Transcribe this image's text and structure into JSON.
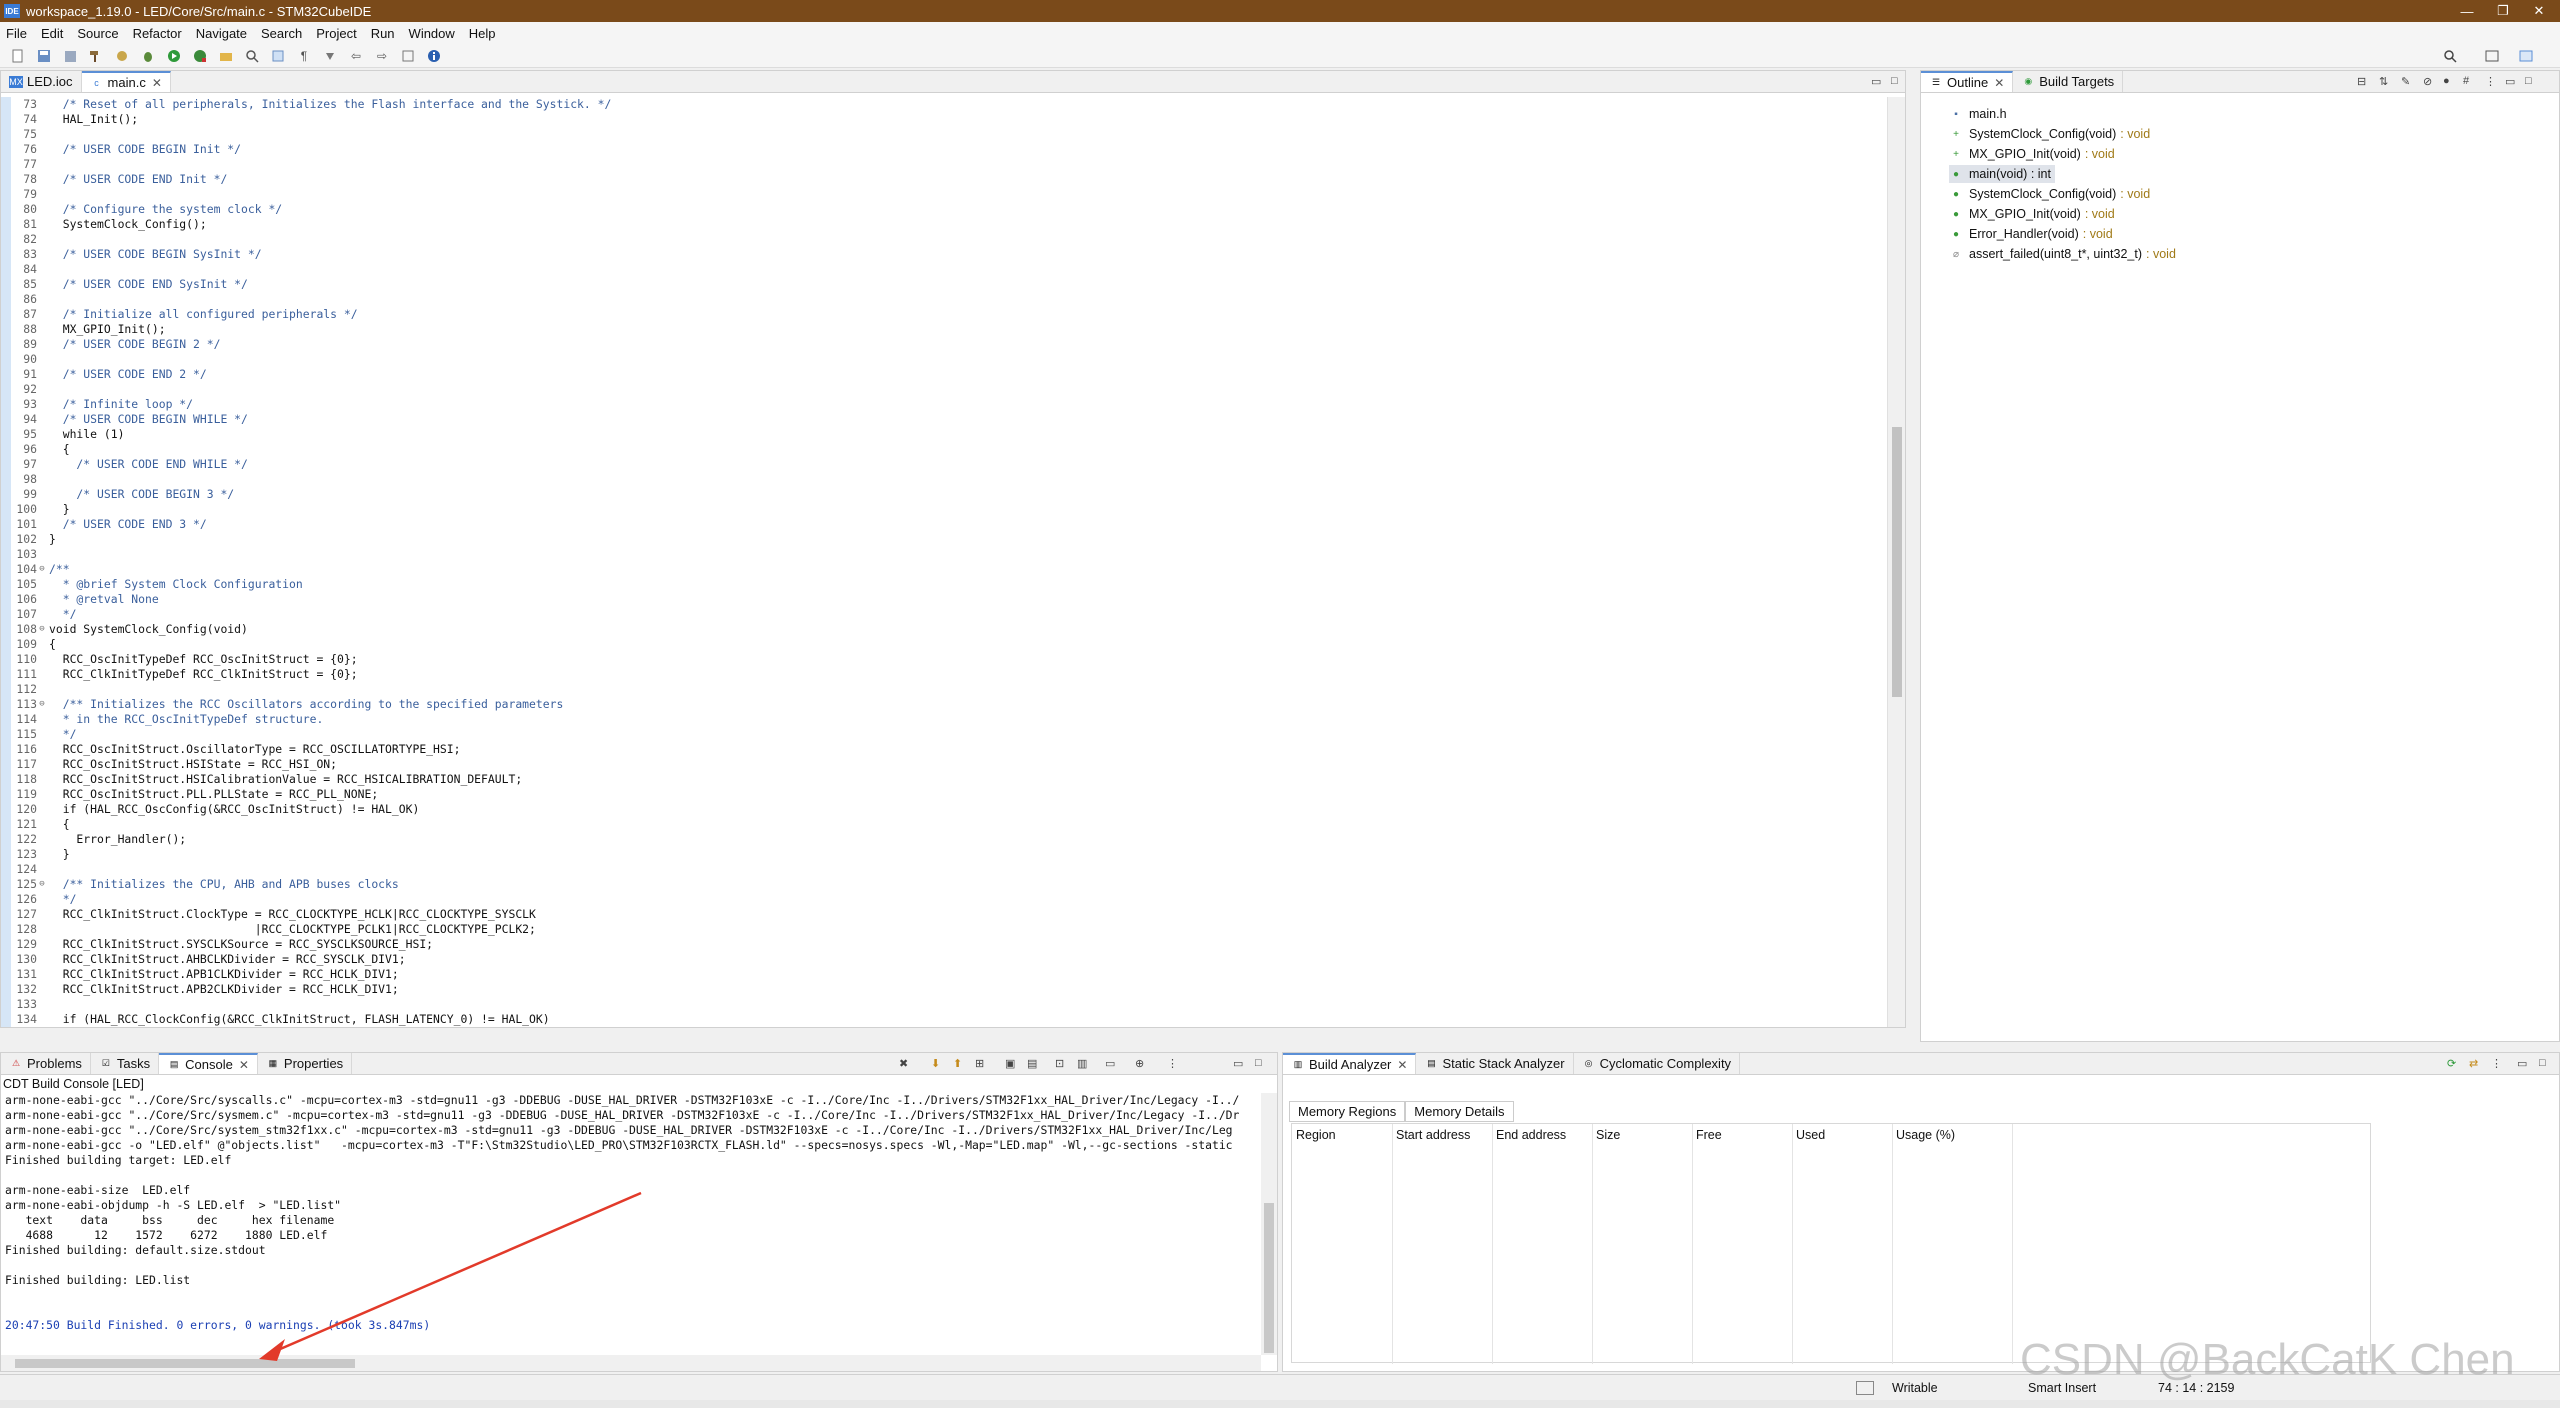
{
  "window": {
    "title": "workspace_1.19.0 - LED/Core/Src/main.c - STM32CubeIDE",
    "logo": "IDE",
    "controls": [
      "—",
      "❐",
      "✕"
    ]
  },
  "menu": [
    "File",
    "Edit",
    "Source",
    "Refactor",
    "Navigate",
    "Search",
    "Project",
    "Run",
    "Window",
    "Help"
  ],
  "editor": {
    "tabs": [
      {
        "label": "LED.ioc",
        "icon": "MX"
      },
      {
        "label": "main.c",
        "icon": "c",
        "close": "✕"
      }
    ],
    "lines": [
      {
        "n": "73",
        "t": "  /* Reset of all peripherals, Initializes the Flash interface and the Systick. */",
        "c": true
      },
      {
        "n": "74",
        "t": "  HAL_Init();",
        "c": false
      },
      {
        "n": "75",
        "t": "",
        "c": false
      },
      {
        "n": "76",
        "t": "  /* USER CODE BEGIN Init */",
        "c": true
      },
      {
        "n": "77",
        "t": "",
        "c": false
      },
      {
        "n": "78",
        "t": "  /* USER CODE END Init */",
        "c": true
      },
      {
        "n": "79",
        "t": "",
        "c": false
      },
      {
        "n": "80",
        "t": "  /* Configure the system clock */",
        "c": true
      },
      {
        "n": "81",
        "t": "  SystemClock_Config();",
        "c": false
      },
      {
        "n": "82",
        "t": "",
        "c": false
      },
      {
        "n": "83",
        "t": "  /* USER CODE BEGIN SysInit */",
        "c": true
      },
      {
        "n": "84",
        "t": "",
        "c": false
      },
      {
        "n": "85",
        "t": "  /* USER CODE END SysInit */",
        "c": true
      },
      {
        "n": "86",
        "t": "",
        "c": false
      },
      {
        "n": "87",
        "t": "  /* Initialize all configured peripherals */",
        "c": true
      },
      {
        "n": "88",
        "t": "  MX_GPIO_Init();",
        "c": false
      },
      {
        "n": "89",
        "t": "  /* USER CODE BEGIN 2 */",
        "c": true
      },
      {
        "n": "90",
        "t": "",
        "c": false
      },
      {
        "n": "91",
        "t": "  /* USER CODE END 2 */",
        "c": true
      },
      {
        "n": "92",
        "t": "",
        "c": false
      },
      {
        "n": "93",
        "t": "  /* Infinite loop */",
        "c": true
      },
      {
        "n": "94",
        "t": "  /* USER CODE BEGIN WHILE */",
        "c": true
      },
      {
        "n": "95",
        "t": "  while (1)",
        "c": false
      },
      {
        "n": "96",
        "t": "  {",
        "c": false
      },
      {
        "n": "97",
        "t": "    /* USER CODE END WHILE */",
        "c": true
      },
      {
        "n": "98",
        "t": "",
        "c": false
      },
      {
        "n": "99",
        "t": "    /* USER CODE BEGIN 3 */",
        "c": true
      },
      {
        "n": "100",
        "t": "  }",
        "c": false
      },
      {
        "n": "101",
        "t": "  /* USER CODE END 3 */",
        "c": true
      },
      {
        "n": "102",
        "t": "}",
        "c": false
      },
      {
        "n": "103",
        "t": "",
        "c": false
      },
      {
        "n": "104",
        "t": "/**",
        "c": true,
        "f": "⊖"
      },
      {
        "n": "105",
        "t": "  * @brief System Clock Configuration",
        "c": true
      },
      {
        "n": "106",
        "t": "  * @retval None",
        "c": true
      },
      {
        "n": "107",
        "t": "  */",
        "c": true
      },
      {
        "n": "108",
        "t": "void SystemClock_Config(void)",
        "c": false,
        "f": "⊖"
      },
      {
        "n": "109",
        "t": "{",
        "c": false
      },
      {
        "n": "110",
        "t": "  RCC_OscInitTypeDef RCC_OscInitStruct = {0};",
        "c": false
      },
      {
        "n": "111",
        "t": "  RCC_ClkInitTypeDef RCC_ClkInitStruct = {0};",
        "c": false
      },
      {
        "n": "112",
        "t": "",
        "c": false
      },
      {
        "n": "113",
        "t": "  /** Initializes the RCC Oscillators according to the specified parameters",
        "c": true,
        "f": "⊖"
      },
      {
        "n": "114",
        "t": "  * in the RCC_OscInitTypeDef structure.",
        "c": true
      },
      {
        "n": "115",
        "t": "  */",
        "c": true
      },
      {
        "n": "116",
        "t": "  RCC_OscInitStruct.OscillatorType = RCC_OSCILLATORTYPE_HSI;",
        "c": false
      },
      {
        "n": "117",
        "t": "  RCC_OscInitStruct.HSIState = RCC_HSI_ON;",
        "c": false
      },
      {
        "n": "118",
        "t": "  RCC_OscInitStruct.HSICalibrationValue = RCC_HSICALIBRATION_DEFAULT;",
        "c": false
      },
      {
        "n": "119",
        "t": "  RCC_OscInitStruct.PLL.PLLState = RCC_PLL_NONE;",
        "c": false
      },
      {
        "n": "120",
        "t": "  if (HAL_RCC_OscConfig(&RCC_OscInitStruct) != HAL_OK)",
        "c": false
      },
      {
        "n": "121",
        "t": "  {",
        "c": false
      },
      {
        "n": "122",
        "t": "    Error_Handler();",
        "c": false
      },
      {
        "n": "123",
        "t": "  }",
        "c": false
      },
      {
        "n": "124",
        "t": "",
        "c": false
      },
      {
        "n": "125",
        "t": "  /** Initializes the CPU, AHB and APB buses clocks",
        "c": true,
        "f": "⊖"
      },
      {
        "n": "126",
        "t": "  */",
        "c": true
      },
      {
        "n": "127",
        "t": "  RCC_ClkInitStruct.ClockType = RCC_CLOCKTYPE_HCLK|RCC_CLOCKTYPE_SYSCLK",
        "c": false
      },
      {
        "n": "128",
        "t": "                              |RCC_CLOCKTYPE_PCLK1|RCC_CLOCKTYPE_PCLK2;",
        "c": false
      },
      {
        "n": "129",
        "t": "  RCC_ClkInitStruct.SYSCLKSource = RCC_SYSCLKSOURCE_HSI;",
        "c": false
      },
      {
        "n": "130",
        "t": "  RCC_ClkInitStruct.AHBCLKDivider = RCC_SYSCLK_DIV1;",
        "c": false
      },
      {
        "n": "131",
        "t": "  RCC_ClkInitStruct.APB1CLKDivider = RCC_HCLK_DIV1;",
        "c": false
      },
      {
        "n": "132",
        "t": "  RCC_ClkInitStruct.APB2CLKDivider = RCC_HCLK_DIV1;",
        "c": false
      },
      {
        "n": "133",
        "t": "",
        "c": false
      },
      {
        "n": "134",
        "t": "  if (HAL_RCC_ClockConfig(&RCC_ClkInitStruct, FLASH_LATENCY_0) != HAL_OK)",
        "c": false
      }
    ]
  },
  "outline": {
    "tabs": [
      {
        "label": "Outline",
        "close": "✕"
      },
      {
        "label": "Build Targets"
      }
    ],
    "items": [
      {
        "name": "main.h",
        "ret": "",
        "icon": "▪",
        "color": "#4a6fa5"
      },
      {
        "name": "SystemClock_Config(void)",
        "ret": ": void",
        "icon": "+",
        "color": "#3a9a3a"
      },
      {
        "name": "MX_GPIO_Init(void)",
        "ret": ": void",
        "icon": "+",
        "color": "#3a9a3a"
      },
      {
        "name": "main(void) : int",
        "ret": "",
        "icon": "●",
        "color": "#3a9a3a"
      },
      {
        "name": "SystemClock_Config(void)",
        "ret": ": void",
        "icon": "●",
        "color": "#3a9a3a"
      },
      {
        "name": "MX_GPIO_Init(void)",
        "ret": ": void",
        "icon": "●",
        "color": "#3a9a3a"
      },
      {
        "name": "Error_Handler(void)",
        "ret": ": void",
        "icon": "●",
        "color": "#3a9a3a"
      },
      {
        "name": "assert_failed(uint8_t*, uint32_t)",
        "ret": ": void",
        "icon": "⌀",
        "color": "#888888"
      }
    ]
  },
  "console": {
    "tabs": [
      {
        "label": "Problems"
      },
      {
        "label": "Tasks"
      },
      {
        "label": "Console",
        "close": "✕"
      },
      {
        "label": "Properties"
      }
    ],
    "header": "CDT Build Console [LED]",
    "lines": [
      {
        "t": "arm-none-eabi-gcc \"../Core/Src/syscalls.c\" -mcpu=cortex-m3 -std=gnu11 -g3 -DDEBUG -DUSE_HAL_DRIVER -DSTM32F103xE -c -I../Core/Inc -I../Drivers/STM32F1xx_HAL_Driver/Inc/Legacy -I../",
        "blue": false
      },
      {
        "t": "arm-none-eabi-gcc \"../Core/Src/sysmem.c\" -mcpu=cortex-m3 -std=gnu11 -g3 -DDEBUG -DUSE_HAL_DRIVER -DSTM32F103xE -c -I../Core/Inc -I../Drivers/STM32F1xx_HAL_Driver/Inc/Legacy -I../Dr",
        "blue": false
      },
      {
        "t": "arm-none-eabi-gcc \"../Core/Src/system_stm32f1xx.c\" -mcpu=cortex-m3 -std=gnu11 -g3 -DDEBUG -DUSE_HAL_DRIVER -DSTM32F103xE -c -I../Core/Inc -I../Drivers/STM32F1xx_HAL_Driver/Inc/Leg",
        "blue": false
      },
      {
        "t": "arm-none-eabi-gcc -o \"LED.elf\" @\"objects.list\"   -mcpu=cortex-m3 -T\"F:\\Stm32Studio\\LED_PRO\\STM32F103RCTX_FLASH.ld\" --specs=nosys.specs -Wl,-Map=\"LED.map\" -Wl,--gc-sections -static",
        "blue": false
      },
      {
        "t": "Finished building target: LED.elf",
        "blue": false
      },
      {
        "t": "",
        "blue": false
      },
      {
        "t": "arm-none-eabi-size  LED.elf",
        "blue": false
      },
      {
        "t": "arm-none-eabi-objdump -h -S LED.elf  > \"LED.list\"",
        "blue": false
      },
      {
        "t": "   text    data     bss     dec     hex filename",
        "blue": false
      },
      {
        "t": "   4688      12    1572    6272    1880 LED.elf",
        "blue": false
      },
      {
        "t": "Finished building: default.size.stdout",
        "blue": false
      },
      {
        "t": "",
        "blue": false
      },
      {
        "t": "Finished building: LED.list",
        "blue": false
      },
      {
        "t": "",
        "blue": false
      },
      {
        "t": "",
        "blue": false
      },
      {
        "t": "20:47:50 Build Finished. 0 errors, 0 warnings. (took 3s.847ms)",
        "blue": true
      }
    ]
  },
  "build_analyzer": {
    "tabs": [
      {
        "label": "Build Analyzer",
        "close": "✕"
      },
      {
        "label": "Static Stack Analyzer"
      },
      {
        "label": "Cyclomatic Complexity"
      }
    ],
    "subtabs": [
      "Memory Regions",
      "Memory Details"
    ],
    "columns": [
      "Region",
      "Start address",
      "End address",
      "Size",
      "Free",
      "Used",
      "Usage (%)"
    ]
  },
  "status": {
    "mode": "Writable",
    "insert": "Smart Insert",
    "position": "74 : 14 : 2159"
  },
  "watermark": "CSDN @BackCatK Chen",
  "colors": {
    "titlebar": "#7a4a1a",
    "accent": "#5b8fd6",
    "comment": "#3a5f9c",
    "console_blue": "#1a3fb3",
    "annotation_arrow": "#e23a2a"
  }
}
